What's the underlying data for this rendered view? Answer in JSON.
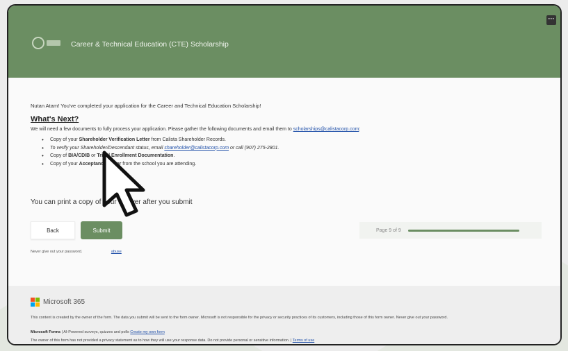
{
  "header": {
    "title": "Career & Technical Education (CTE) Scholarship",
    "more_button": "···",
    "logo_icon": "calista-logo-icon",
    "accent_color": "#6b8e62"
  },
  "main": {
    "intro": "Nutan Atam! You've completed your application for the Career and Technical Education Scholarship!",
    "whats_next_heading": "What's Next?",
    "gather_text": "We will need a few documents to fully process your application. Please gather the following documents and email them to",
    "gather_email": "scholarships@calistacorp.com",
    "gather_colon": ":",
    "docs": {
      "item1_prefix": "Copy of your",
      "item1_bold": "Shareholder Verification Letter",
      "item1_suffix": "from Calista      Shareholder Records.",
      "item2_prefix": "To verify your Shareholder/Descendant status, email",
      "item2_email": "shareholder@calistacorp.com",
      "item2_suffix": "or call (907) 275-2801.",
      "item3_prefix": "Copy of",
      "item3_bold1": "BIA/CDIB",
      "item3_mid": "or",
      "item3_bold2": "Tribal Enrollment Documentation",
      "item3_end": ".",
      "item4_prefix": "Copy of your",
      "item4_bold": "Acceptance Letter",
      "item4_suffix": "from the school you are attending."
    },
    "print_note": "You can print a copy of your answer after you submit",
    "back_label": "Back",
    "submit_label": "Submit",
    "progress_text": "Page 9 of 9",
    "progress_fraction": 1.0,
    "password_note": "Never give out your password.",
    "report_link": "abuse"
  },
  "footer": {
    "brand": "Microsoft 365",
    "brand_icon": "microsoft-logo-icon",
    "ms_colors": [
      "#f25022",
      "#7fba00",
      "#00a4ef",
      "#ffb900"
    ],
    "disclaimer": "This content is created by the owner of the form. The data you submit will be sent to the form owner. Microsoft is not responsible for the privacy or security practices of its customers, including those of this form owner. Never give out your password.",
    "forms_label": "Microsoft Forms",
    "forms_text": "| AI-Powered surveys, quizzes and polls",
    "forms_link": "Create my own form",
    "privacy_text": "The owner of this form has not provided a privacy statement as to how they will use your response data. Do not provide personal or sensitive information. |",
    "terms_link": "Terms of use"
  }
}
